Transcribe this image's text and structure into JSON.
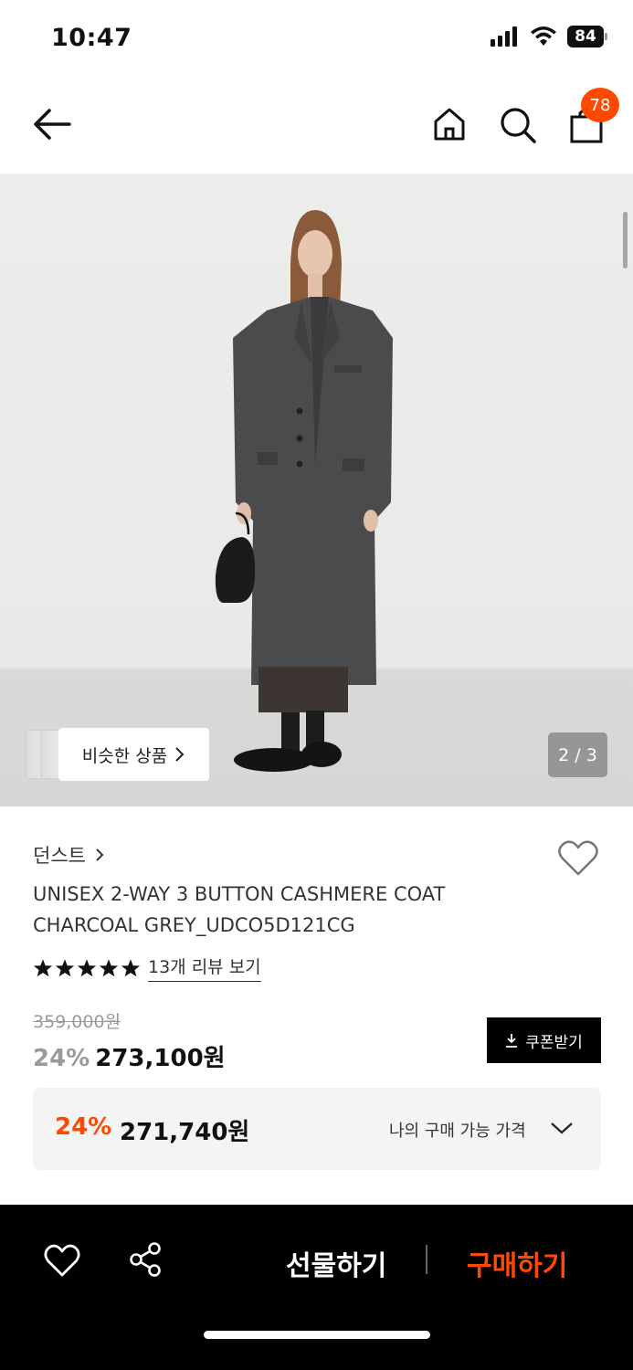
{
  "status_bar": {
    "time": "10:47",
    "battery": "84"
  },
  "header": {
    "cart_count": "78"
  },
  "gallery": {
    "similar_label": "비슷한 상품",
    "page_indicator": "2 / 3"
  },
  "product": {
    "brand": "던스트",
    "title_line1": "UNISEX 2-WAY 3 BUTTON CASHMERE COAT",
    "title_line2": "CHARCOAL GREY_UDCO5D121CG",
    "rating_stars": 5,
    "review_link": "13개 리뷰 보기",
    "original_price": "359,000원",
    "discount_rate": "24%",
    "sale_price": "273,100원",
    "coupon_label": "쿠폰받기"
  },
  "my_price": {
    "rate": "24%",
    "value": "271,740원",
    "label": "나의 구매 가능 가격"
  },
  "bottom_bar": {
    "gift_label": "선물하기",
    "buy_label": "구매하기"
  },
  "colors": {
    "accent": "#ff4800",
    "bar_bg": "#000000",
    "muted": "#9a9a9a"
  }
}
